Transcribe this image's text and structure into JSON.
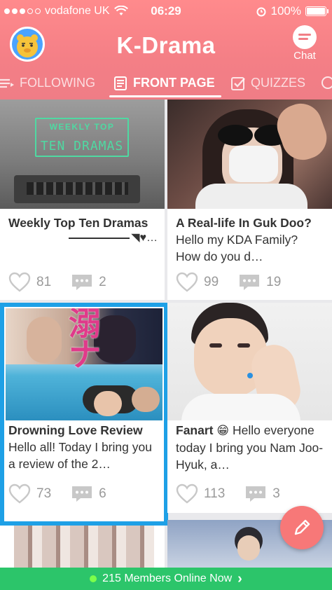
{
  "status_bar": {
    "carrier": "vodafone UK",
    "time": "06:29",
    "battery": "100%"
  },
  "header": {
    "title": "K-Drama",
    "chat_label": "Chat"
  },
  "tabs": [
    {
      "label": "FOLLOWING",
      "icon": "list-icon"
    },
    {
      "label": "FRONT PAGE",
      "icon": "document-icon",
      "active": true
    },
    {
      "label": "QUIZZES",
      "icon": "checkbox-icon"
    }
  ],
  "posts": [
    {
      "title": "Weekly Top Ten Dramas",
      "title_suffix": "◥♥…",
      "thumb_text_line1": "WEEKLY TOP",
      "thumb_text_line2": "TEN DRAMAS",
      "likes": "81",
      "comments": "2"
    },
    {
      "title_bold": "A Real-life In Guk Doo?",
      "title_rest": " Hello my KDA Family? How do you d…",
      "likes": "99",
      "comments": "19"
    },
    {
      "title_bold": "Drowning Love Review",
      "title_rest": "Hello all! Today I bring you a review of the 2…",
      "likes": "73",
      "comments": "6"
    },
    {
      "title_bold": "Fanart",
      "title_emoji": "😁",
      "title_rest": " Hello everyone today I bring you Nam Joo-Hyuk, a…",
      "likes": "113",
      "comments": "3"
    }
  ],
  "online_bar": {
    "text": "215 Members Online Now",
    "arrow": "›"
  },
  "colors": {
    "header": "#f47f86",
    "selected_outline": "#1ea0e6",
    "online_bar": "#2cc56a",
    "fab": "#f77878"
  }
}
